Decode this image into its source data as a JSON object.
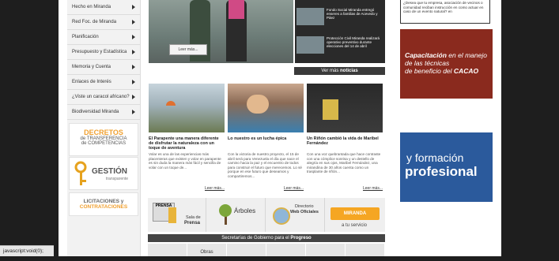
{
  "sidebar": {
    "items": [
      {
        "label": "Hecho en Miranda"
      },
      {
        "label": "Red Foc. de Miranda"
      },
      {
        "label": "Planificación"
      },
      {
        "label": "Presupuesto y Estadística"
      },
      {
        "label": "Memoria y Cuenta"
      },
      {
        "label": "Enlaces de Interés"
      },
      {
        "label": "¿Viste un caracol africano?"
      },
      {
        "label": "Biodiversidad Miranda"
      }
    ],
    "decretos": {
      "title": "DECRETOS",
      "line2": "de TRANSFERENCIA",
      "line3": "de COMPETENCIAS"
    },
    "gestion": {
      "title": "GESTIÓN",
      "sub": "transparente"
    },
    "licitaciones": {
      "line1": "LICITACIONES y",
      "line2": "CONTRATACIONES"
    }
  },
  "hero": {
    "leer_label": "Leer más...",
    "side_items": [
      {
        "text": "Fondo Social Miranda entregó enseres a familias de Acevedo y Páez"
      },
      {
        "text": "Protección Civil Miranda realizará operativo preventivo durante elecciones del 14 de abril"
      }
    ],
    "ver_mas": {
      "prefix": "Ver más",
      "bold": "noticias"
    }
  },
  "news": [
    {
      "title": "El Parapente una manera diferente de disfrutar la naturaleza con un toque de aventura",
      "body": "Volar es una de las experiencias más placenteras que existen y volar en parapente es sin duda la manera más fácil y sencilla de volar con un toque de...",
      "more": "Leer más..."
    },
    {
      "title": "Lo nuestro es un lucha épica",
      "body": "Con la victoria de nuestro proyecto, el 15 de abril será para Venezuela el día que nace el camino hacia la paz y el encuentro de todos para construir el futuro que merecemos. Lo sé porque en ese futuro que deseamos y compartiremos...",
      "more": "Leer más..."
    },
    {
      "title": "Un Riñón cambió la vida de Maribel Fernández",
      "body": "Con una voz quebrantada que hace contraste con una cómplice sonrisa y un destello de alegría en sus ojos, Maribel Fernández, una mirandina de 30 años cuenta como un trasplante de riñón...",
      "more": "Leer más..."
    }
  ],
  "banners": {
    "sala": {
      "line1": "Sala de",
      "line2": "Prensa",
      "tag": "PRENSA"
    },
    "arboles": {
      "label": "Árboles"
    },
    "directorio": {
      "line1": "Directorio",
      "line2": "Web Oficiales"
    },
    "miranda": {
      "line1": "MIRANDA",
      "line2": "a tu servicio"
    }
  },
  "secretarias": {
    "prefix": "Secretarías de Gobierno para el",
    "bold": "Progreso",
    "first_cell": "Obras"
  },
  "right": {
    "text": "¿Desea que tu empresa, asociación de vecinos o comunidad reciban instrucción en como actuar en caso de un evento natural? en",
    "cacao": {
      "line1": "Capacitación",
      "line1b": "en el manejo",
      "line2": "de las técnicas",
      "line3": "de beneficio del",
      "line3b": "CACAO"
    },
    "formacion": {
      "line1": "y formación",
      "line2": "profesional"
    }
  },
  "status_bar": "javascript:void(0);",
  "colors": {
    "cacao_bg": "#8a2a1e",
    "formacion_bg": "#2b5a9c",
    "accent_orange": "#f5a623"
  }
}
